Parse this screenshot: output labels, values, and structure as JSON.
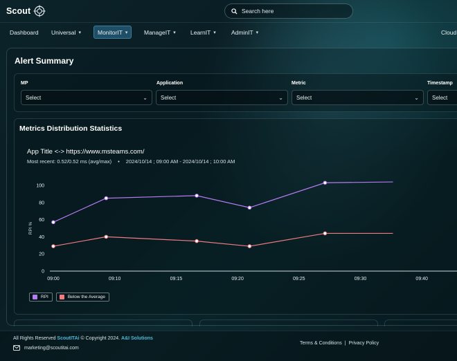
{
  "header": {
    "logo_text": "Scout",
    "search_placeholder": "Search here"
  },
  "nav": {
    "items": [
      {
        "label": "Dashboard"
      },
      {
        "label": "Universal"
      },
      {
        "label": "MonitorIT"
      },
      {
        "label": "ManageIT"
      },
      {
        "label": "LearnIT"
      },
      {
        "label": "AdminIT"
      },
      {
        "label": "Cloud"
      }
    ],
    "active": "MonitorIT"
  },
  "alert_summary": {
    "title": "Alert Summary",
    "filters": [
      {
        "label": "MP",
        "value": "Select"
      },
      {
        "label": "Application",
        "value": "Select"
      },
      {
        "label": "Metric",
        "value": "Select"
      },
      {
        "label": "Timestamp",
        "value": "Select"
      }
    ]
  },
  "metrics": {
    "title": "Metrics Distribution Statistics",
    "app_title": "App Title <-> https://www.msteams.com/",
    "most_recent": "Most recent: 0.52/0.52 ms (avg/max)",
    "separator": "•",
    "time_range": "2024/10/14 ; 09:00 AM - 2024/10/14 ; 10:00 AM"
  },
  "chart_data": {
    "type": "line",
    "ylabel": "RPI %",
    "xlabel": "",
    "x_ticks": [
      "09:00",
      "09:10",
      "09:15",
      "09:20",
      "09:25",
      "09:30",
      "09:40"
    ],
    "y_ticks": [
      0,
      20,
      40,
      60,
      80,
      100
    ],
    "ylim": [
      0,
      100
    ],
    "grid": false,
    "legend": "bottom-left",
    "series": [
      {
        "name": "RPI",
        "color": "#b57bf0",
        "points": [
          [
            "09:00",
            57
          ],
          [
            "09:07",
            85
          ],
          [
            "09:19",
            88
          ],
          [
            "09:26",
            74
          ],
          [
            "09:36",
            103
          ],
          [
            "09:45",
            104
          ]
        ]
      },
      {
        "name": "Below the Average",
        "color": "#f07b83",
        "points": [
          [
            "09:00",
            29
          ],
          [
            "09:07",
            40
          ],
          [
            "09:19",
            35
          ],
          [
            "09:26",
            29
          ],
          [
            "09:36",
            44
          ],
          [
            "09:45",
            44
          ]
        ]
      }
    ]
  },
  "footer": {
    "rights": "All Rights Reserved",
    "brand": "ScoutITAi",
    "copy": "© Copyright 2024.",
    "company": "A&I Solutions",
    "email": "marketing@scoutitai.com",
    "terms": "Terms & Conditions",
    "divider": "|",
    "privacy": "Privacy Policy"
  },
  "colors": {
    "accent": "#4fb8d6",
    "nav_active_bg": "#1e4f66",
    "rpi": "#b57bf0",
    "below_avg": "#f07b83"
  }
}
